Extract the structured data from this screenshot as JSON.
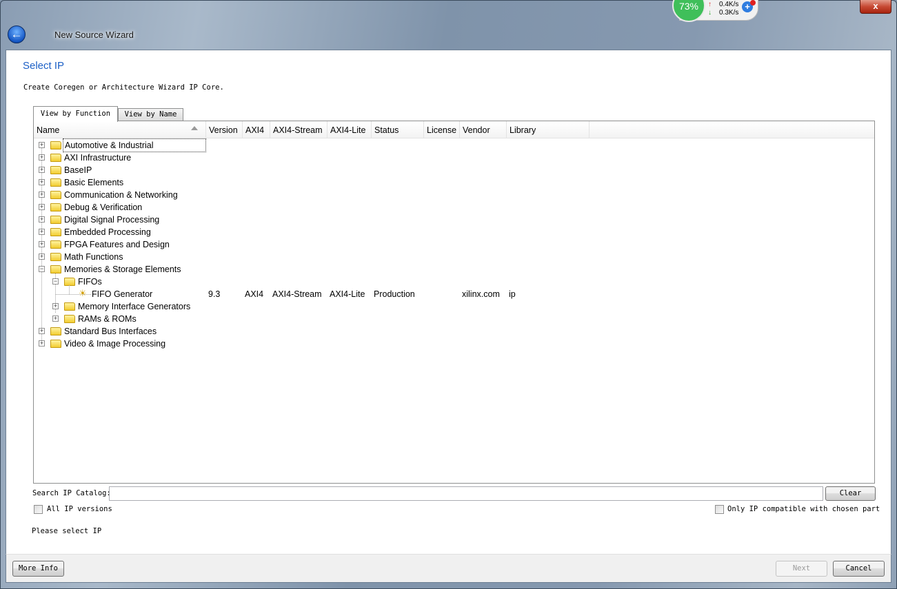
{
  "window": {
    "title": "New Source Wizard",
    "close_label": "x"
  },
  "tray": {
    "percent": "73%",
    "upload": "0.4K/s",
    "download": "0.3K/s"
  },
  "page": {
    "heading": "Select IP",
    "description": "Create Coregen or Architecture Wizard IP Core."
  },
  "tabs": [
    {
      "label": "View by Function",
      "active": true
    },
    {
      "label": "View by Name",
      "active": false
    }
  ],
  "columns": [
    "Name",
    "Version",
    "AXI4",
    "AXI4-Stream",
    "AXI4-Lite",
    "Status",
    "License",
    "Vendor",
    "Library"
  ],
  "tree": [
    {
      "label": "Automotive & Industrial",
      "depth": 0,
      "type": "folder",
      "expanded": false,
      "focused": true
    },
    {
      "label": "AXI Infrastructure",
      "depth": 0,
      "type": "folder",
      "expanded": false
    },
    {
      "label": "BaseIP",
      "depth": 0,
      "type": "folder",
      "expanded": false
    },
    {
      "label": "Basic Elements",
      "depth": 0,
      "type": "folder",
      "expanded": false
    },
    {
      "label": "Communication & Networking",
      "depth": 0,
      "type": "folder",
      "expanded": false
    },
    {
      "label": "Debug & Verification",
      "depth": 0,
      "type": "folder",
      "expanded": false
    },
    {
      "label": "Digital Signal Processing",
      "depth": 0,
      "type": "folder",
      "expanded": false
    },
    {
      "label": "Embedded Processing",
      "depth": 0,
      "type": "folder",
      "expanded": false
    },
    {
      "label": "FPGA Features and Design",
      "depth": 0,
      "type": "folder",
      "expanded": false
    },
    {
      "label": "Math Functions",
      "depth": 0,
      "type": "folder",
      "expanded": false
    },
    {
      "label": "Memories & Storage Elements",
      "depth": 0,
      "type": "folder",
      "expanded": true
    },
    {
      "label": "FIFOs",
      "depth": 1,
      "type": "folder",
      "expanded": true
    },
    {
      "label": "FIFO Generator",
      "depth": 2,
      "type": "ip",
      "version": "9.3",
      "axi4": "AXI4",
      "axi4_stream": "AXI4-Stream",
      "axi4_lite": "AXI4-Lite",
      "status": "Production",
      "license": "",
      "vendor": "xilinx.com",
      "library": "ip"
    },
    {
      "label": "Memory Interface Generators",
      "depth": 1,
      "type": "folder",
      "expanded": false
    },
    {
      "label": "RAMs & ROMs",
      "depth": 1,
      "type": "folder",
      "expanded": false
    },
    {
      "label": "Standard Bus Interfaces",
      "depth": 0,
      "type": "folder",
      "expanded": false
    },
    {
      "label": "Video & Image Processing",
      "depth": 0,
      "type": "folder",
      "expanded": false
    }
  ],
  "search": {
    "label": "Search IP Catalog:",
    "value": "",
    "clear_label": "Clear"
  },
  "options": {
    "all_versions": {
      "label": "All IP versions",
      "checked": false
    },
    "compatible_only": {
      "label": "Only IP compatible with chosen part",
      "checked": false
    }
  },
  "status_text": "Please select IP",
  "buttons": {
    "more_info": "More Info",
    "next": "Next",
    "cancel": "Cancel"
  }
}
